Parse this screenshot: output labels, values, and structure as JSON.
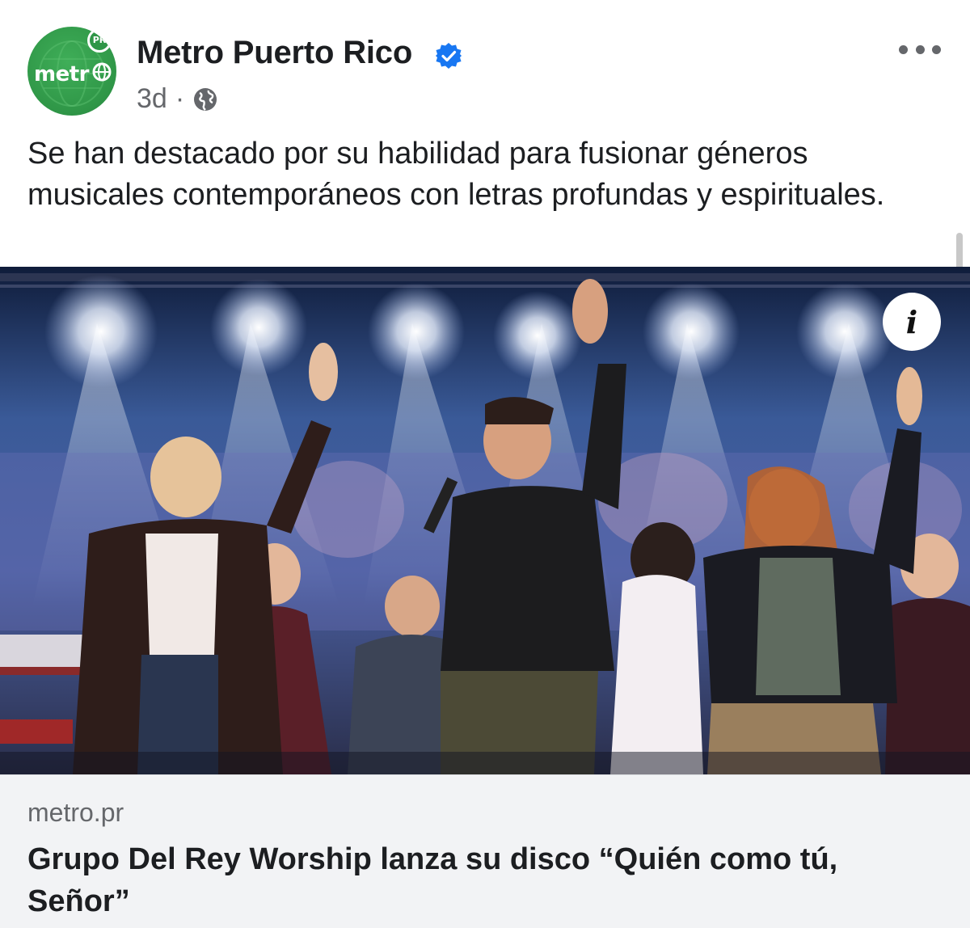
{
  "post": {
    "page_name": "Metro Puerto Rico",
    "verified": true,
    "time": "3d",
    "separator": "·",
    "audience_icon": "globe-icon",
    "more_icon": "more-options-icon",
    "message": "Se han destacado por su habilidad para fusionar géneros musicales contemporáneos con letras profundas y espirituales.",
    "avatar": {
      "word": "metr",
      "badge": "PR",
      "color": "#2f9647"
    },
    "photo": {
      "description_icon": "info-icon",
      "info_glyph": "i"
    },
    "link_preview": {
      "domain": "metro.pr",
      "title": "Grupo Del Rey Worship lanza su disco “Quién como tú, Señor”"
    }
  },
  "colors": {
    "text": "#1c1e21",
    "secondary": "#65676b",
    "verified_blue": "#1877f2",
    "link_bg": "#f2f3f5",
    "brand_green": "#2f9647"
  }
}
